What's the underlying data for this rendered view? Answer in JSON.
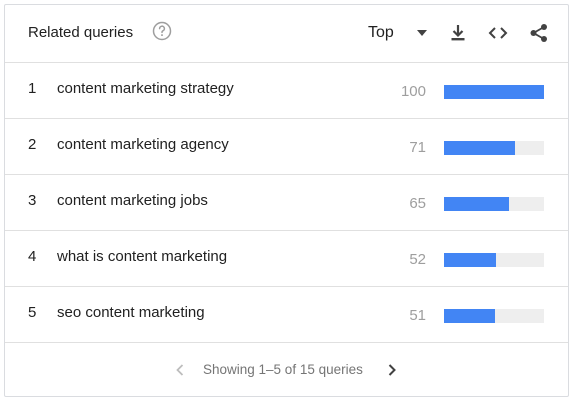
{
  "header": {
    "title": "Related queries",
    "help_icon": "help-circle-icon",
    "select_value": "Top",
    "icons": [
      "chevron-down-icon",
      "download-icon",
      "embed-code-icon",
      "share-icon"
    ]
  },
  "rows": [
    {
      "rank": "1",
      "query": "content marketing strategy",
      "value": "100",
      "fraction": 1.0
    },
    {
      "rank": "2",
      "query": "content marketing agency",
      "value": "71",
      "fraction": 0.71
    },
    {
      "rank": "3",
      "query": "content marketing jobs",
      "value": "65",
      "fraction": 0.65
    },
    {
      "rank": "4",
      "query": "what is content marketing",
      "value": "52",
      "fraction": 0.52
    },
    {
      "rank": "5",
      "query": "seo content marketing",
      "value": "51",
      "fraction": 0.51
    }
  ],
  "footer": {
    "pager_text": "Showing 1–5 of 15 queries",
    "prev_icon": "chevron-left-icon",
    "next_icon": "chevron-right-icon"
  },
  "colors": {
    "bar": "#4285f4",
    "bar_track": "#eeeeee",
    "value_text": "#9e9e9e"
  }
}
